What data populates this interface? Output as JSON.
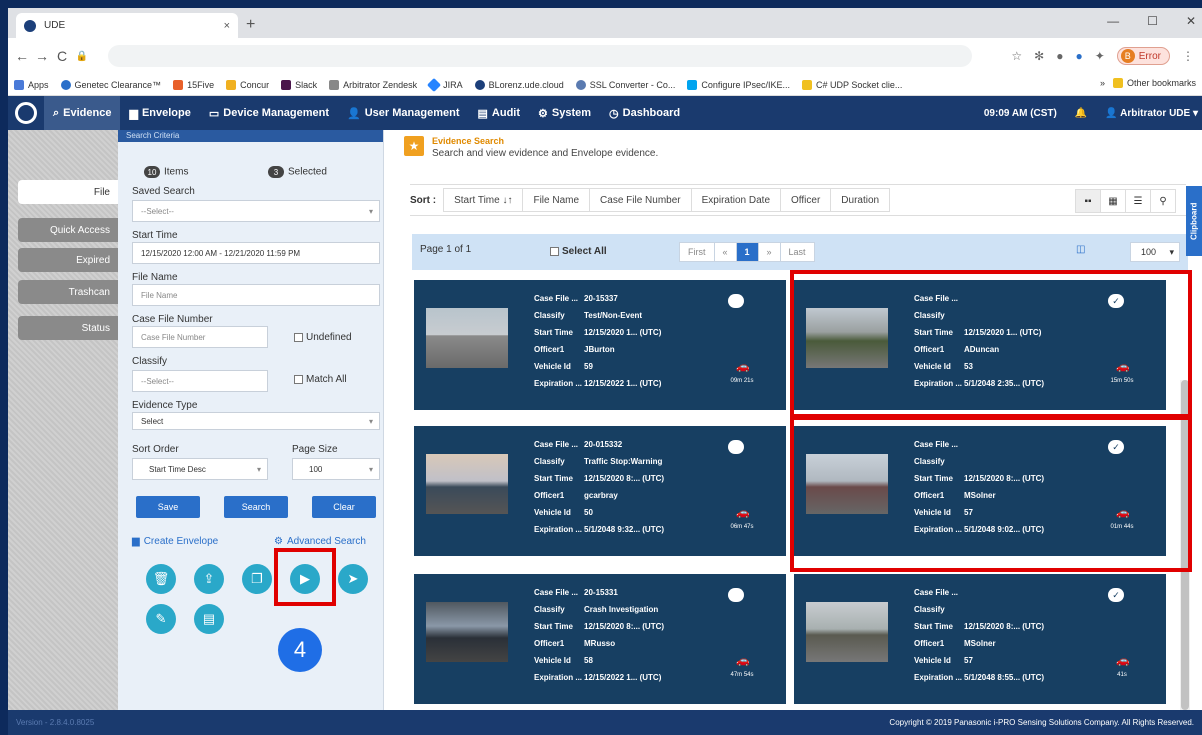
{
  "browser": {
    "tab_title": "UDE",
    "tab_close": "×",
    "new_tab": "+",
    "error_label": "Error",
    "error_badge": "B",
    "bookmarks": [
      {
        "label": "Apps",
        "color": "#4a7ad8"
      },
      {
        "label": "Genetec Clearance™",
        "color": "#2a6fc9"
      },
      {
        "label": "15Five",
        "color": "#e8602a"
      },
      {
        "label": "Concur",
        "color": "#f0b020"
      },
      {
        "label": "Slack",
        "color": "#4a154b"
      },
      {
        "label": "Arbitrator Zendesk",
        "color": "#888888"
      },
      {
        "label": "JIRA",
        "color": "#2684ff"
      },
      {
        "label": "BLorenz.ude.cloud",
        "color": "#1c3f7a"
      },
      {
        "label": "SSL Converter - Co...",
        "color": "#5a7ab0"
      },
      {
        "label": "Configure IPsec/IKE...",
        "color": "#00a4ef"
      },
      {
        "label": "C# UDP Socket clie...",
        "color": "#f0c020"
      }
    ],
    "bookmarks_more": "»",
    "other_bookmarks": "Other bookmarks"
  },
  "nav": {
    "items": [
      {
        "label": "Evidence",
        "icon": "search-icon",
        "active": true
      },
      {
        "label": "Envelope",
        "icon": "folder-icon"
      },
      {
        "label": "Device Management",
        "icon": "monitor-icon"
      },
      {
        "label": "User Management",
        "icon": "user-icon"
      },
      {
        "label": "Audit",
        "icon": "chart-icon"
      },
      {
        "label": "System",
        "icon": "gear-icon"
      },
      {
        "label": "Dashboard",
        "icon": "dashboard-icon"
      }
    ],
    "time": "09:09 AM (CST)",
    "user": "Arbitrator UDE"
  },
  "left_tabs": [
    "File",
    "Quick Access",
    "Expired",
    "Trashcan",
    "Status"
  ],
  "search": {
    "header": "Search Criteria",
    "items_count": "10",
    "items_label": "Items",
    "selected_count": "3",
    "selected_label": "Selected",
    "saved_search_label": "Saved Search",
    "saved_search_value": "--Select--",
    "start_time_label": "Start Time",
    "start_time_value": "12/15/2020 12:00 AM - 12/21/2020 11:59 PM",
    "file_name_label": "File Name",
    "file_name_placeholder": "File Name",
    "case_file_label": "Case File Number",
    "case_file_placeholder": "Case File Number",
    "undefined_label": "Undefined",
    "classify_label": "Classify",
    "classify_value": "--Select--",
    "match_all_label": "Match All",
    "evidence_type_label": "Evidence Type",
    "evidence_type_value": "Select",
    "sort_order_label": "Sort Order",
    "sort_order_value": "Start Time Desc",
    "page_size_label": "Page Size",
    "page_size_value": "100",
    "save": "Save",
    "search": "Search",
    "clear": "Clear",
    "create_envelope": "Create Envelope",
    "advanced_search": "Advanced Search"
  },
  "step_number": "4",
  "main": {
    "title": "Evidence Search",
    "subtitle": "Search and view evidence and Envelope evidence.",
    "sort_label": "Sort :",
    "sort_options": [
      "Start Time ↓↑",
      "File Name",
      "Case File Number",
      "Expiration Date",
      "Officer",
      "Duration"
    ],
    "page_info": "Page 1 of 1",
    "select_all": "Select All",
    "pager": [
      "First",
      "«",
      "1",
      "»",
      "Last"
    ],
    "page_size": "100",
    "clipboard": "Clipboard"
  },
  "cards": [
    {
      "case_file": "20-15337",
      "classify": "Test/Non-Event",
      "start_time": "12/15/2020 1... (UTC)",
      "officer": "JBurton",
      "vehicle": "59",
      "expiration": "12/15/2022 1... (UTC)",
      "duration": "09m 21s",
      "checked": false,
      "highlight": false
    },
    {
      "case_file": "",
      "classify": "",
      "start_time": "12/15/2020 1... (UTC)",
      "officer": "ADuncan",
      "vehicle": "53",
      "expiration": "5/1/2048 2:35... (UTC)",
      "duration": "15m 50s",
      "checked": true,
      "highlight": true
    },
    {
      "case_file": "20-015332",
      "classify": "Traffic Stop:Warning",
      "start_time": "12/15/2020 8:... (UTC)",
      "officer": "gcarbray",
      "vehicle": "50",
      "expiration": "5/1/2048 9:32... (UTC)",
      "duration": "06m 47s",
      "checked": false,
      "highlight": false
    },
    {
      "case_file": "",
      "classify": "",
      "start_time": "12/15/2020 8:... (UTC)",
      "officer": "MSolner",
      "vehicle": "57",
      "expiration": "5/1/2048 9:02... (UTC)",
      "duration": "01m 44s",
      "checked": true,
      "highlight": true
    },
    {
      "case_file": "20-15331",
      "classify": "Crash Investigation",
      "start_time": "12/15/2020 8:... (UTC)",
      "officer": "MRusso",
      "vehicle": "58",
      "expiration": "12/15/2022 1... (UTC)",
      "duration": "47m 54s",
      "checked": false,
      "highlight": false
    },
    {
      "case_file": "",
      "classify": "",
      "start_time": "12/15/2020 8:... (UTC)",
      "officer": "MSolner",
      "vehicle": "57",
      "expiration": "5/1/2048 8:55... (UTC)",
      "duration": "41s",
      "checked": true,
      "highlight": false
    }
  ],
  "card_labels": {
    "case_file": "Case File ...",
    "classify": "Classify",
    "start_time": "Start Time",
    "officer": "Officer1",
    "vehicle": "Vehicle Id",
    "expiration": "Expiration ..."
  },
  "footer": {
    "version": "Version - 2.8.4.0.8025",
    "copyright": "Copyright © 2019 Panasonic i-PRO Sensing Solutions Company. All Rights Reserved."
  },
  "colors": {
    "accent": "#2a6fc9",
    "nav": "#1a3a6e",
    "card": "#173f62",
    "highlight": "#e00000"
  }
}
